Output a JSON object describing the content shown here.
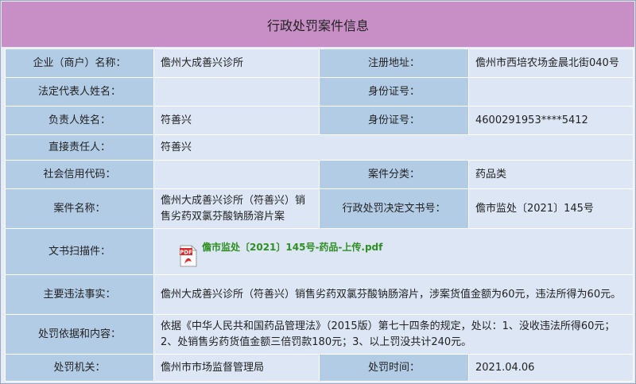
{
  "title": "行政处罚案件信息",
  "rows": [
    {
      "l1": "企业（商户）名称：",
      "v1": "儋州大成善兴诊所",
      "l2": "注册地址：",
      "v2": "儋州市西培农场金晨北街040号"
    },
    {
      "l1": "法定代表人姓名：",
      "v1": "",
      "l2": "身份证号：",
      "v2": ""
    },
    {
      "l1": "负责人姓名：",
      "v1": "符善兴",
      "l2": "身份证号：",
      "v2": "4600291953****5412"
    },
    {
      "l1": "直接责任人：",
      "v1": "符善兴"
    },
    {
      "l1": "社会信用代码：",
      "v1": "",
      "l2": "案件分类：",
      "v2": "药品类"
    },
    {
      "l1": "案件名称：",
      "v1": "儋州大成善兴诊所（符善兴）销售劣药双氯芬酸钠肠溶片案",
      "l2": "行政处罚决定文书号：",
      "v2": "儋市监处〔2021〕145号"
    }
  ],
  "attachment": {
    "label": "文书扫描件：",
    "file": "儋市监处〔2021〕145号-药品-上传.pdf",
    "icon": "pdf-icon",
    "icon_text": "PDF"
  },
  "facts": {
    "label": "主要违法事实：",
    "value": "儋州大成善兴诊所（符善兴）销售劣药双氯芬酸钠肠溶片，涉案货值金额为60元，违法所得为60元。"
  },
  "basis": {
    "label": "处罚依据和内容：",
    "value": "依据《中华人民共和国药品管理法》（2015版）第七十四条的规定，处以：1、没收违法所得60元；2、处销售劣药货值金额三倍罚款180元；3、以上罚没共计240元。"
  },
  "footer": {
    "l1": "处罚机关：",
    "v1": "儋州市市场监督管理局",
    "l2": "处罚时间：",
    "v2": "2021.04.06"
  },
  "colors": {
    "title_bg": "#c88ec6",
    "label_bg": "#b3cce6",
    "value_bg": "#dce6f5",
    "link": "#2f8f23"
  }
}
